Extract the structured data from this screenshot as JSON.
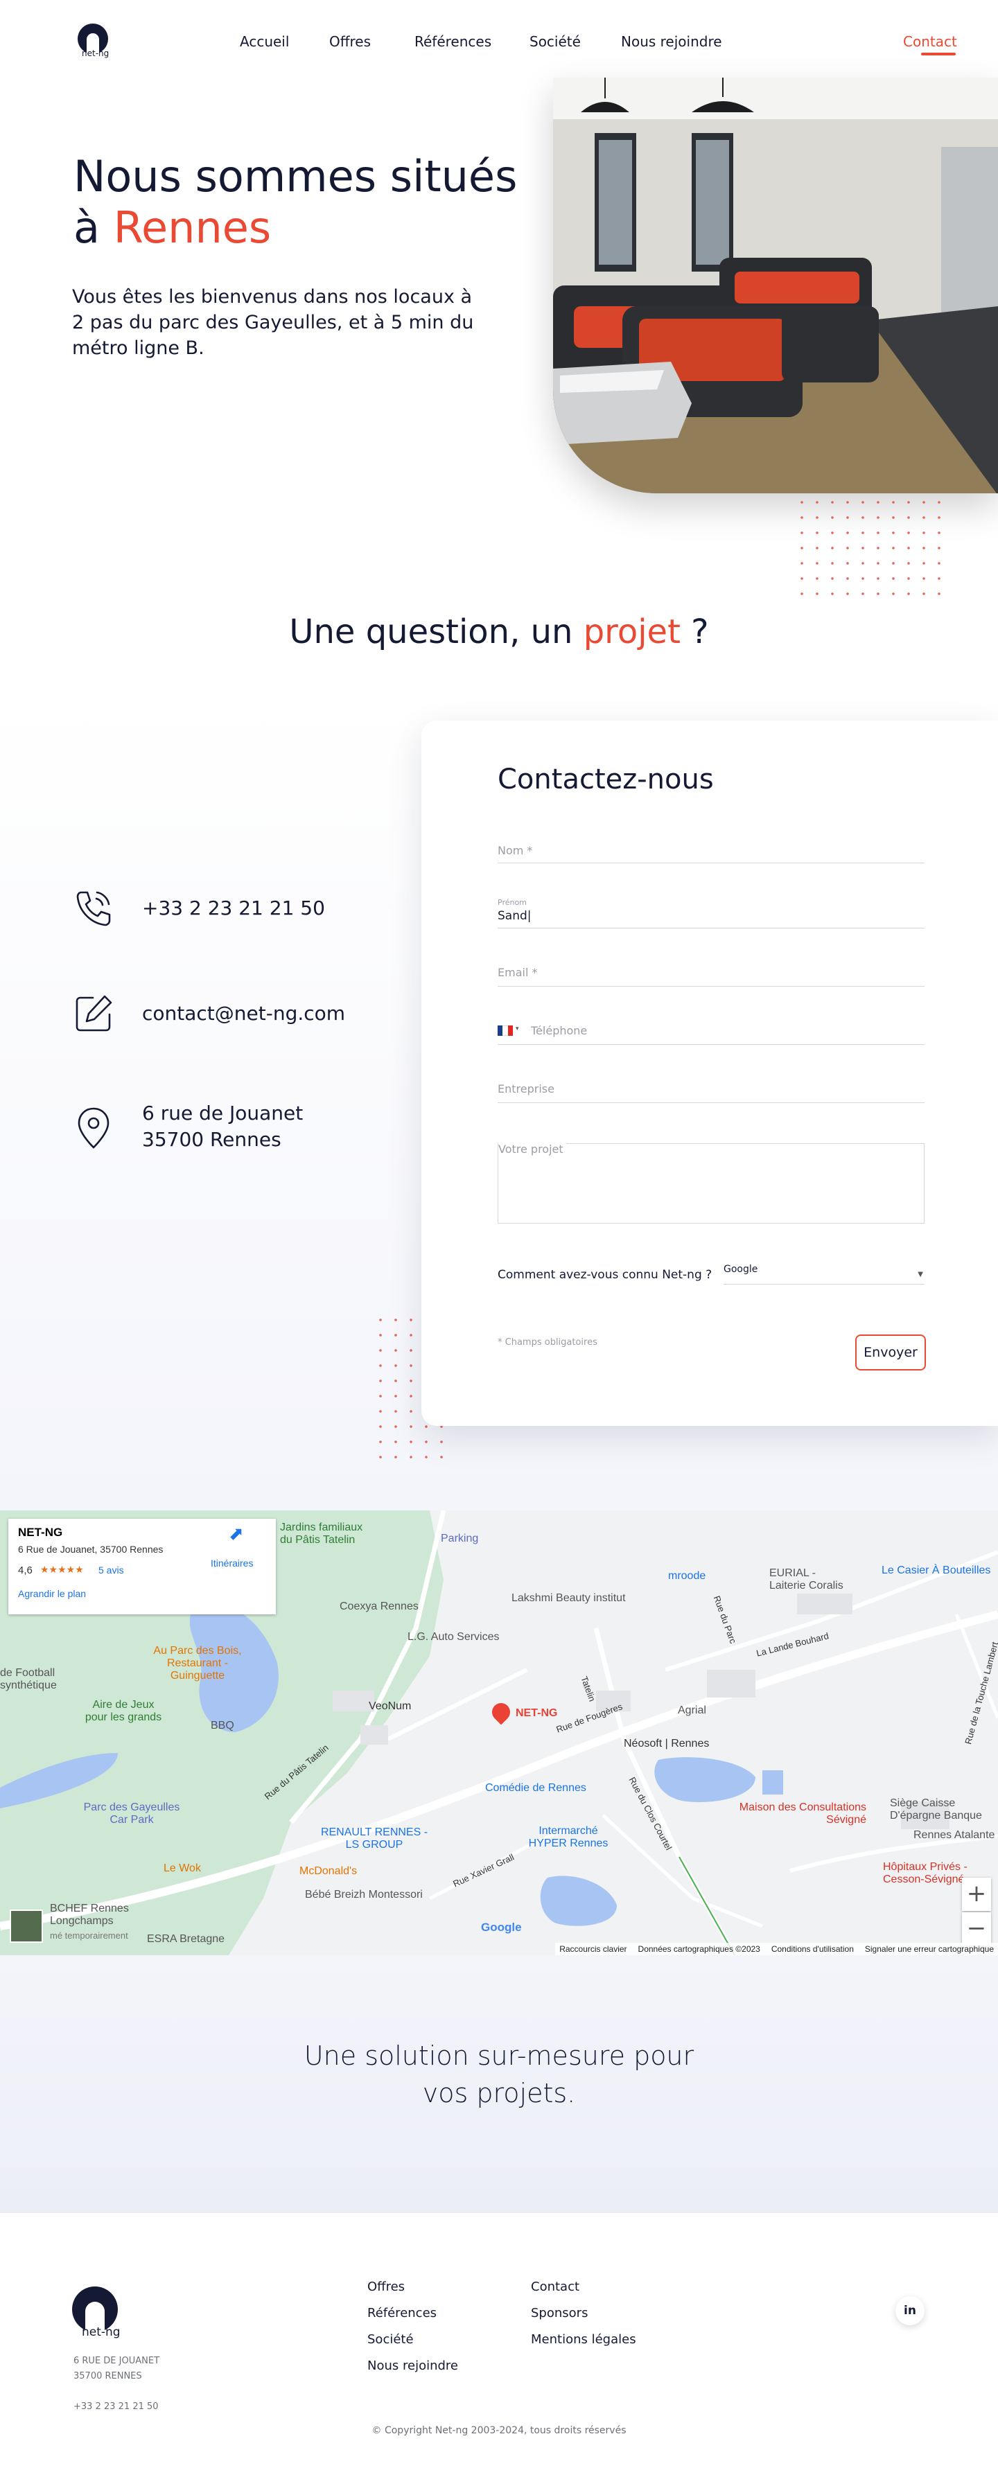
{
  "brand": {
    "logo_text": "net-ng",
    "accent_color": "#ea4a34",
    "navy_color": "#141a33"
  },
  "nav": {
    "items": [
      "Accueil",
      "Offres",
      "Références",
      "Société",
      "Nous rejoindre"
    ],
    "contact": "Contact"
  },
  "hero": {
    "title_line1": "Nous sommes situés",
    "title_prefix": "à",
    "title_city": "Rennes",
    "text": "Vous êtes les bienvenus dans nos locaux à 2 pas du parc des Gayeulles, et à 5 min du métro ligne B."
  },
  "question": {
    "prefix": "Une question, un",
    "highlight": "projet",
    "suffix": "?"
  },
  "contact_info": {
    "phone": "+33 2 23 21 21 50",
    "email": "contact@net-ng.com",
    "address_line1": "6 rue de Jouanet",
    "address_line2": "35700 Rennes",
    "icons": [
      "phone-icon",
      "edit-icon",
      "location-pin-icon"
    ]
  },
  "form": {
    "title": "Contactez-nous",
    "nom_placeholder": "Nom *",
    "prenom_label": "Prénom",
    "prenom_value": "Sand",
    "email_placeholder": "Email *",
    "phone_placeholder": "Téléphone",
    "entreprise_placeholder": "Entreprise",
    "projet_placeholder": "Votre projet",
    "how_known_label": "Comment avez-vous connu Net-ng ?",
    "how_known_value": "Google",
    "required_note": "* Champs obligatoires",
    "submit_label": "Envoyer"
  },
  "map": {
    "card_title": "NET-NG",
    "card_address": "6 Rue de Jouanet, 35700 Rennes",
    "rating": "4,6",
    "stars": 4.6,
    "reviews": "5 avis",
    "directions": "Itinéraires",
    "enlarge": "Agrandir le plan",
    "marker_label": "NET-NG",
    "labels": {
      "jardins": "Jardins familiaux du Pâtis Tatelin",
      "parking": "Parking",
      "coexya": "Coexya Rennes",
      "lakshmi": "Lakshmi Beauty institut",
      "mroode": "mroode",
      "eurial": "EURIAL - Laiterie Coralis",
      "casier": "Le Casier À Bouteilles",
      "lg": "L.G. Auto Services",
      "football": "de Football synthétique",
      "aupac": "Au Parc des Bois, Restaurant - Guinguette",
      "airejeux": "Aire de Jeux pour les grands",
      "bbq": "BBQ",
      "veonum": "VeoNum",
      "agrial": "Agrial",
      "neosoft": "Néosoft | Rennes",
      "comedie": "Comédie de Rennes",
      "parcgayeulles": "Parc des Gayeulles Car Park",
      "renault": "RENAULT RENNES - LS GROUP",
      "intermarche": "Intermarché HYPER Rennes",
      "maison": "Maison des Consultations Sévigné",
      "siege": "Siège Caisse D'épargne Banque",
      "atalante": "Rennes Atalante",
      "hopitaux": "Hôpitaux Privés - Cesson-Sévigné",
      "lewok": "Le Wok",
      "mcdo": "McDonald's",
      "bebe": "Bébé Breizh Montessori",
      "bchef": "BCHEF Rennes Longchamps",
      "bchef_status": "mé temporairement",
      "esra": "ESRA Bretagne",
      "roads": [
        "Rue de Fougères",
        "Rue du Pâtis Tatelin",
        "Rue Xavier Grall",
        "Rue du Clos Courtel",
        "La Lande Bouhard",
        "Rue de la Touche Lambert",
        "Rue du Parc",
        "Tatelin"
      ]
    },
    "footer": [
      "Raccourcis clavier",
      "Données cartographiques ©2023",
      "Conditions d'utilisation",
      "Signaler une erreur cartographique"
    ],
    "google": "Google"
  },
  "tagline": {
    "line1": "Une solution sur-mesure pour",
    "line2": "vos projets."
  },
  "footer": {
    "address_line1": "6 RUE DE JOUANET",
    "address_line2": "35700 RENNES",
    "phone": "+33 2 23 21 21 50",
    "col1": [
      "Offres",
      "Références",
      "Société",
      "Nous rejoindre"
    ],
    "col2": [
      "Contact",
      "Sponsors",
      "Mentions légales"
    ],
    "linkedin": "in",
    "copyright": "© Copyright Net-ng 2003-2024, tous droits réservés"
  }
}
